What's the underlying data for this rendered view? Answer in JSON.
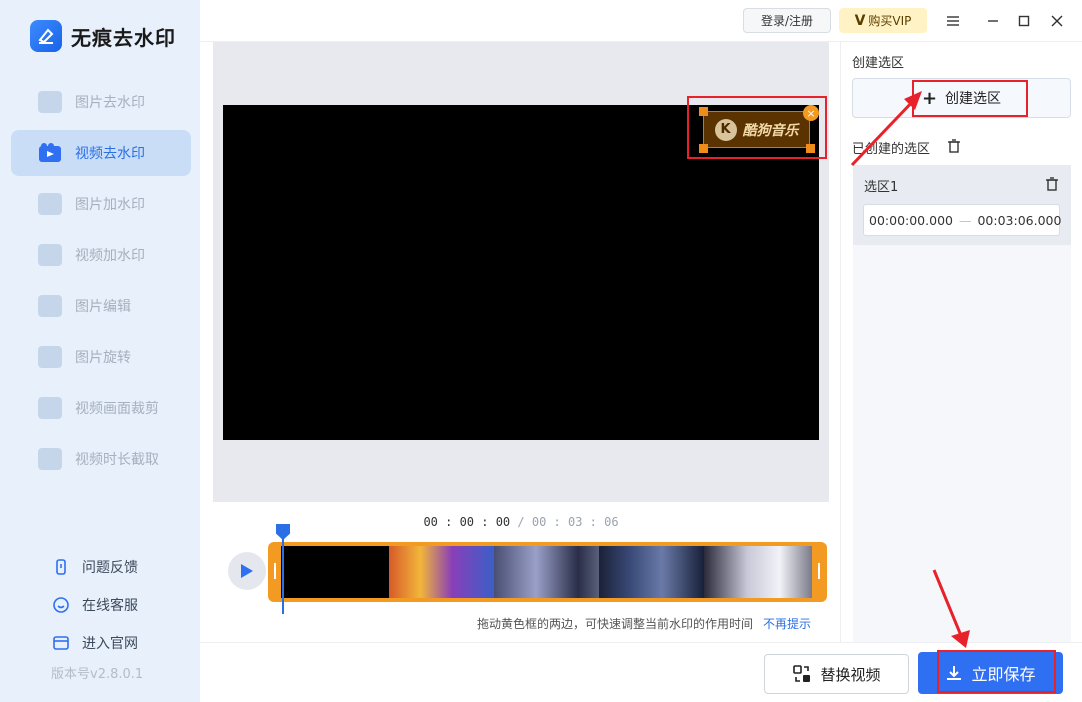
{
  "app": {
    "name": "无痕去水印",
    "version": "版本号v2.8.0.1"
  },
  "sidebar": {
    "items": [
      {
        "label": "图片去水印",
        "active": false
      },
      {
        "label": "视频去水印",
        "active": true
      },
      {
        "label": "图片加水印",
        "active": false
      },
      {
        "label": "视频加水印",
        "active": false
      },
      {
        "label": "图片编辑",
        "active": false
      },
      {
        "label": "图片旋转",
        "active": false
      },
      {
        "label": "视频画面裁剪",
        "active": false
      },
      {
        "label": "视频时长截取",
        "active": false
      }
    ],
    "links": [
      {
        "label": "问题反馈",
        "icon": "feedback-icon"
      },
      {
        "label": "在线客服",
        "icon": "support-icon"
      },
      {
        "label": "进入官网",
        "icon": "website-icon"
      }
    ]
  },
  "topbar": {
    "login_label": "登录/注册",
    "vip_label": "购买VIP",
    "vip_mark": "V"
  },
  "preview": {
    "watermark_logo": "K",
    "watermark_text": "酷狗音乐"
  },
  "timeline": {
    "current": "00 : 00 : 00",
    "separator": " / ",
    "total": "00 : 03 : 06"
  },
  "hint": {
    "text": "拖动黄色框的两边，可快速调整当前水印的作用时间",
    "dismiss": "不再提示"
  },
  "panel": {
    "create_title": "创建选区",
    "create_button": "创建选区",
    "created_title": "已创建的选区",
    "selections": [
      {
        "name": "选区1",
        "start": "00:00:00.000",
        "end": "00:03:06.000"
      }
    ]
  },
  "actions": {
    "replace_label": "替换视频",
    "save_label": "立即保存"
  },
  "colors": {
    "accent": "#2f6ff1",
    "highlight": "#e8222a",
    "track": "#f39a22"
  }
}
